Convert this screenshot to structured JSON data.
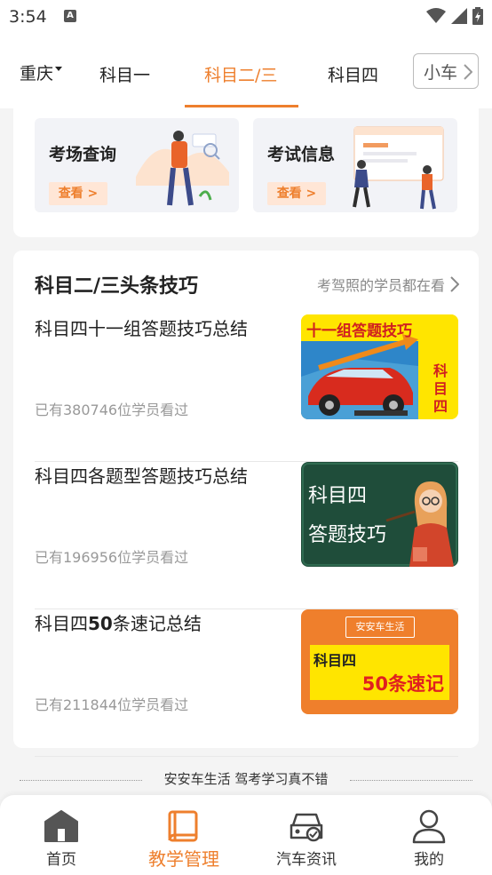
{
  "status_bar": {
    "time": "3:54",
    "notification_badge": "A",
    "icons": [
      "wifi-icon",
      "signal-icon",
      "battery-icon"
    ]
  },
  "header": {
    "city": "重庆",
    "tabs": [
      {
        "label": "科目一",
        "active": false
      },
      {
        "label": "科目二/三",
        "active": true
      },
      {
        "label": "科目四",
        "active": false
      },
      {
        "label": "小车",
        "active": false
      }
    ]
  },
  "quick_cards": [
    {
      "title": "考场查询",
      "button": "查看 >"
    },
    {
      "title": "考试信息",
      "button": "查看 >"
    }
  ],
  "tips": {
    "heading": "科目二/三头条技巧",
    "more": "考驾照的学员都在看",
    "articles": [
      {
        "title": "科目四十一组答题技巧总结",
        "meta": "已有380746位学员看过",
        "thumb_title": "十一组答题技巧",
        "thumb_badge": [
          "科",
          "目",
          "四"
        ]
      },
      {
        "title": "科目四各题型答题技巧总结",
        "meta": "已有196956位学员看过",
        "thumb_line1": "科目四",
        "thumb_line2": "答题技巧"
      },
      {
        "title_prefix": "科目四",
        "title_bold": "50",
        "title_suffix": "条速记总结",
        "meta": "已有211844位学员看过",
        "thumb_logo": "安安车生活",
        "thumb_line1": "科目四",
        "thumb_line2": "50条速记"
      }
    ]
  },
  "slogan": "安安车生活 驾考学习真不错",
  "bottom_nav": [
    {
      "label": "首页",
      "icon": "home-icon",
      "active": false
    },
    {
      "label": "教学管理",
      "icon": "book-icon",
      "active": true
    },
    {
      "label": "汽车资讯",
      "icon": "car-icon",
      "active": false
    },
    {
      "label": "我的",
      "icon": "user-icon",
      "active": false
    }
  ],
  "colors": {
    "accent": "#ee7f2d",
    "background": "#f4f4f4",
    "muted_text": "#999999"
  }
}
